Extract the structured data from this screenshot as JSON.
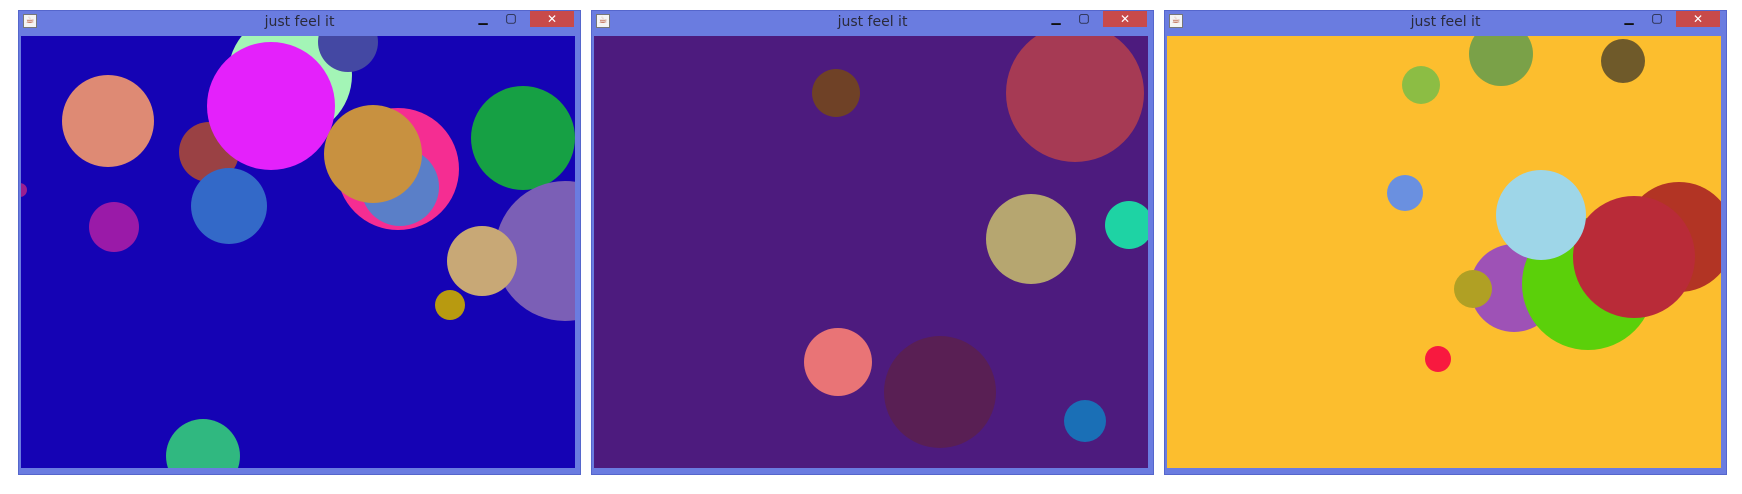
{
  "windows": [
    {
      "title": "just feel it",
      "background": "#1503b4",
      "circles": [
        {
          "color": "#a3f5b6"
        },
        {
          "color": "#4448a3"
        },
        {
          "color": "#de8a74"
        },
        {
          "color": "#9a4144"
        },
        {
          "color": "#e421fb"
        },
        {
          "color": "#f52d92"
        },
        {
          "color": "#5a7fc8"
        },
        {
          "color": "#c89140"
        },
        {
          "color": "#16a044"
        },
        {
          "color": "#7b5fb6"
        },
        {
          "color": "#c8a876"
        },
        {
          "color": "#9a1aa8"
        },
        {
          "color": "#3369c8"
        },
        {
          "color": "#b89a10"
        },
        {
          "color": "#30b880"
        },
        {
          "color": "#9a1f90"
        }
      ]
    },
    {
      "title": "just feel it",
      "background": "#4d1b7e",
      "circles": [
        {
          "color": "#a63a54"
        },
        {
          "color": "#6f4126"
        },
        {
          "color": "#b6a670"
        },
        {
          "color": "#1ed3a4"
        },
        {
          "color": "#e97476"
        },
        {
          "color": "#591f54"
        },
        {
          "color": "#1a6fb6"
        }
      ]
    },
    {
      "title": "just feel it",
      "background": "#fcbe2e",
      "circles": [
        {
          "color": "#7aa148"
        },
        {
          "color": "#6f5a2a"
        },
        {
          "color": "#8cbd44"
        },
        {
          "color": "#6a90e0"
        },
        {
          "color": "#9e52b6"
        },
        {
          "color": "#5bd00a"
        },
        {
          "color": "#b23424"
        },
        {
          "color": "#b92b38"
        },
        {
          "color": "#9ed6e8"
        },
        {
          "color": "#b0a024"
        },
        {
          "color": "#f8193f"
        }
      ]
    }
  ]
}
